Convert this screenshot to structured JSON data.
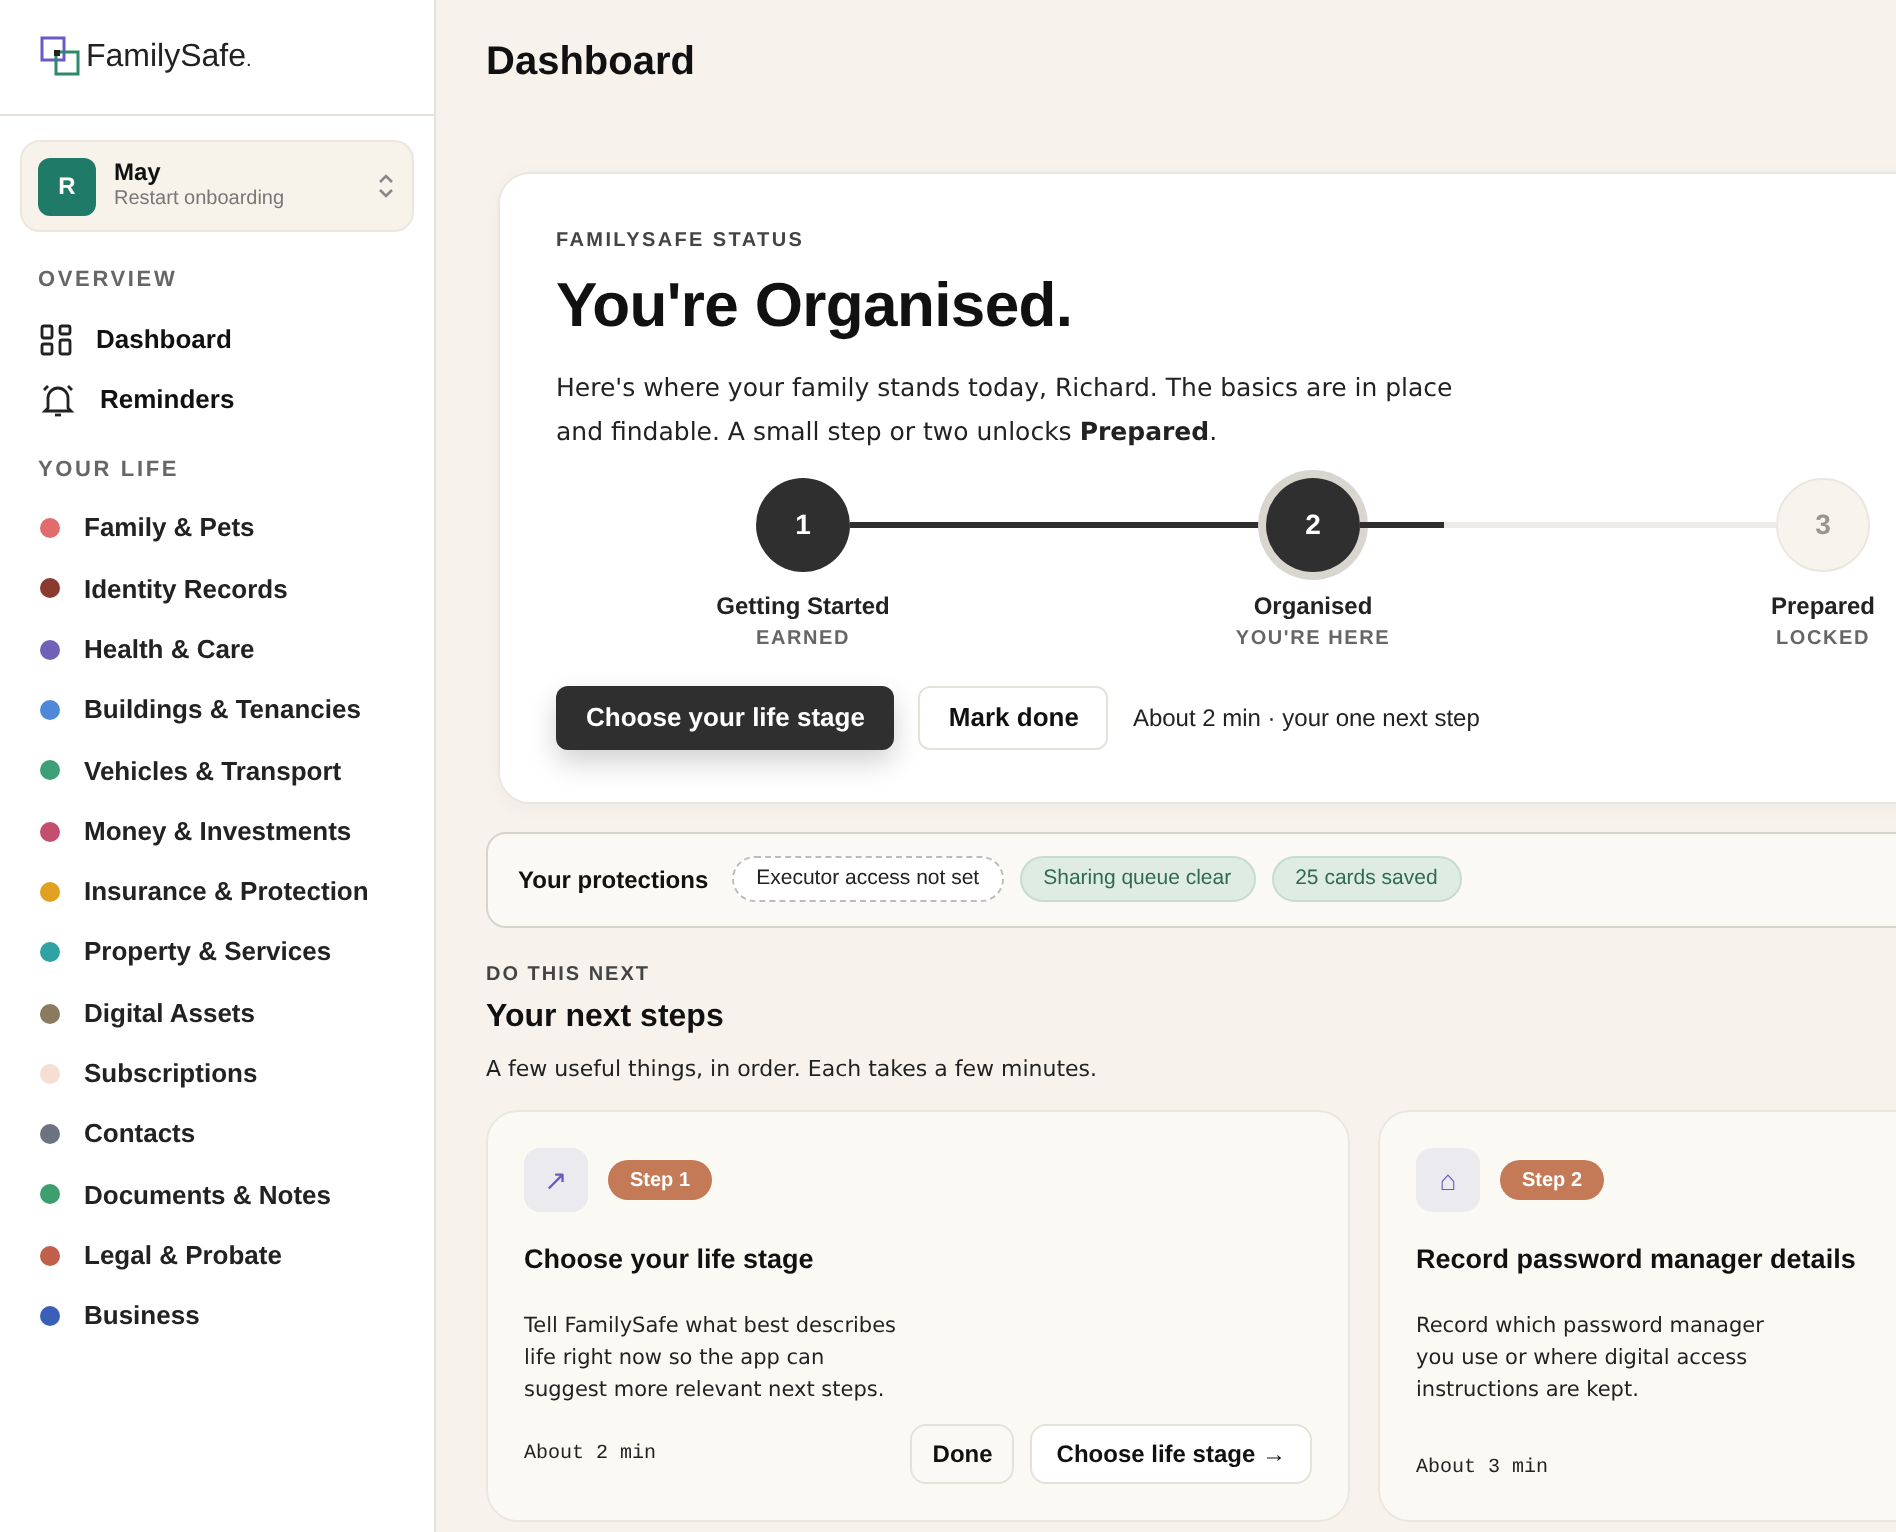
{
  "brand": {
    "name": "FamilySafe",
    "suffix": "."
  },
  "profile": {
    "initial": "R",
    "name": "May",
    "subtitle": "Restart onboarding"
  },
  "overview": {
    "heading": "OVERVIEW",
    "items": [
      {
        "kind": "dashboard",
        "label": "Dashboard"
      },
      {
        "kind": "reminders",
        "label": "Reminders"
      }
    ]
  },
  "your_life": {
    "heading": "YOUR LIFE",
    "items": [
      {
        "label": "Family & Pets",
        "color": "#e06c6c"
      },
      {
        "label": "Identity Records",
        "color": "#8b3a2f"
      },
      {
        "label": "Health & Care",
        "color": "#7060b8"
      },
      {
        "label": "Buildings & Tenancies",
        "color": "#4f88d8"
      },
      {
        "label": "Vehicles & Transport",
        "color": "#3e9e78"
      },
      {
        "label": "Money & Investments",
        "color": "#c44e6e"
      },
      {
        "label": "Insurance & Protection",
        "color": "#e0a020"
      },
      {
        "label": "Property & Services",
        "color": "#2fa3a3"
      },
      {
        "label": "Digital Assets",
        "color": "#8a7a60"
      },
      {
        "label": "Subscriptions",
        "color": "#f6ded4"
      },
      {
        "label": "Contacts",
        "color": "#6b7280"
      },
      {
        "label": "Documents & Notes",
        "color": "#3e9e6e"
      },
      {
        "label": "Legal & Probate",
        "color": "#c0604a"
      },
      {
        "label": "Business",
        "color": "#3a5fb8"
      }
    ]
  },
  "page_title": "Dashboard",
  "status": {
    "eyebrow": "FAMILYSAFE STATUS",
    "title": "You're Organised.",
    "description": "Here's where your family stands today, Richard. The basics are in place and findable. A small step or two unlocks **Prepared**.",
    "progress": {
      "level": 0.2
    },
    "steps": [
      {
        "number": "1",
        "label": "Getting Started",
        "caption": "EARNED",
        "kind": "earned"
      },
      {
        "number": "2",
        "label": "Organised",
        "caption": "YOU'RE HERE",
        "kind": "current"
      },
      {
        "number": "3",
        "label": "Prepared",
        "caption": "LOCKED",
        "kind": "locked"
      }
    ],
    "primary_button": "Choose your life stage",
    "secondary_button": "Mark done",
    "note": "About 2 min · your one next step"
  },
  "protections": {
    "label": "Your protections",
    "chips": [
      {
        "text": "Executor access not set",
        "kind": "pending"
      },
      {
        "text": "Sharing queue clear",
        "kind": "ok"
      },
      {
        "text": "25 cards saved",
        "kind": "ok"
      }
    ]
  },
  "next_steps": {
    "eyebrow": "DO THIS NEXT",
    "title": "Your next steps",
    "subtitle": "A few useful things, in order. Each takes a few minutes.",
    "cards": [
      {
        "icon": "↗",
        "badge": "Step 1",
        "title": "Choose your life stage",
        "description": "Tell FamilySafe what best describes life right now so the app can suggest more relevant next steps.",
        "time": "About 2 min",
        "done_button": "Done",
        "action_button": "Choose life stage →"
      },
      {
        "icon": "⌂",
        "badge": "Step 2",
        "title": "Record password manager details",
        "description": "Record which password manager you use or where digital access instructions are kept.",
        "time": "About 3 min"
      }
    ]
  }
}
